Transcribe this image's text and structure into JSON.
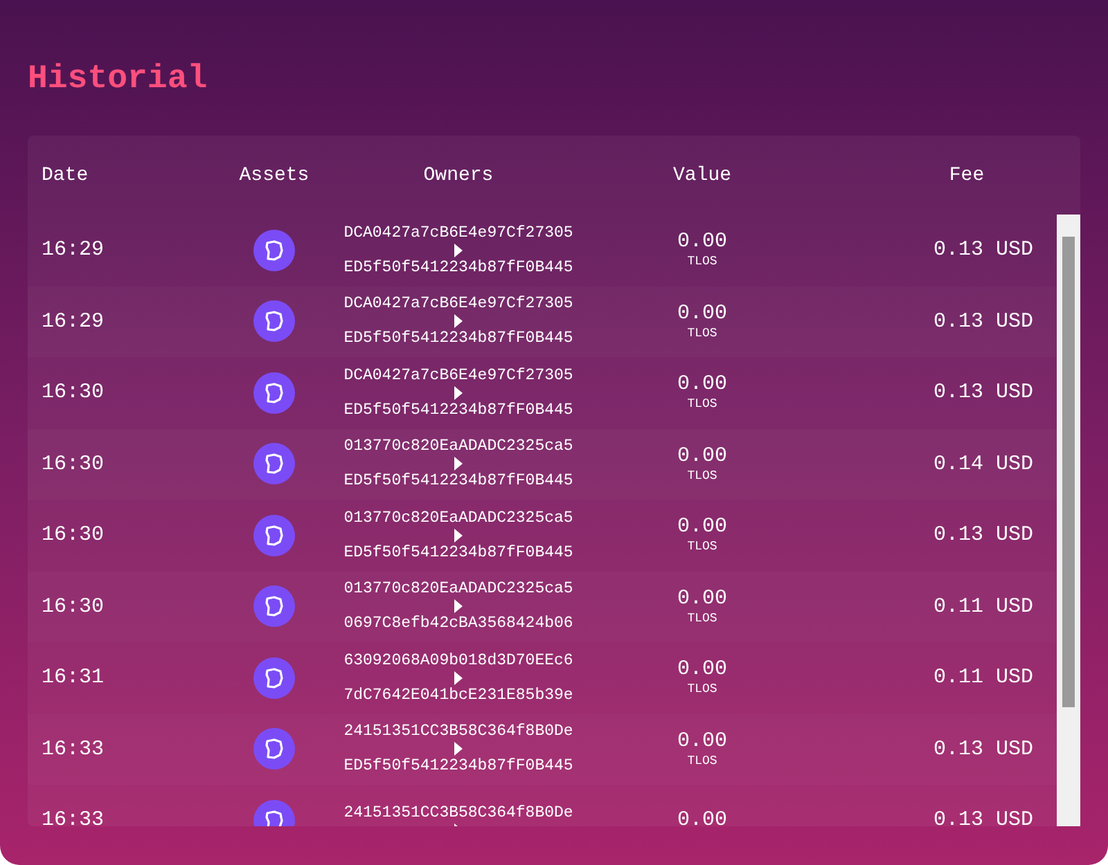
{
  "title": "Historial",
  "table": {
    "columns": [
      "Date",
      "Assets",
      "Owners",
      "Value",
      "Fee"
    ],
    "rows": [
      {
        "date": "16:29",
        "from": "DCA0427a7cB6E4e97Cf27305",
        "to": "ED5f50f5412234b87fF0B445",
        "value": "0.00",
        "unit": "TLOS",
        "fee": "0.13 USD"
      },
      {
        "date": "16:29",
        "from": "DCA0427a7cB6E4e97Cf27305",
        "to": "ED5f50f5412234b87fF0B445",
        "value": "0.00",
        "unit": "TLOS",
        "fee": "0.13 USD"
      },
      {
        "date": "16:30",
        "from": "DCA0427a7cB6E4e97Cf27305",
        "to": "ED5f50f5412234b87fF0B445",
        "value": "0.00",
        "unit": "TLOS",
        "fee": "0.13 USD"
      },
      {
        "date": "16:30",
        "from": "013770c820EaADADC2325ca5",
        "to": "ED5f50f5412234b87fF0B445",
        "value": "0.00",
        "unit": "TLOS",
        "fee": "0.14 USD"
      },
      {
        "date": "16:30",
        "from": "013770c820EaADADC2325ca5",
        "to": "ED5f50f5412234b87fF0B445",
        "value": "0.00",
        "unit": "TLOS",
        "fee": "0.13 USD"
      },
      {
        "date": "16:30",
        "from": "013770c820EaADADC2325ca5",
        "to": "0697C8efb42cBA3568424b06",
        "value": "0.00",
        "unit": "TLOS",
        "fee": "0.11 USD"
      },
      {
        "date": "16:31",
        "from": "63092068A09b018d3D70EEc6",
        "to": "7dC7642E041bcE231E85b39e",
        "value": "0.00",
        "unit": "TLOS",
        "fee": "0.11 USD"
      },
      {
        "date": "16:33",
        "from": "24151351CC3B58C364f8B0De",
        "to": "ED5f50f5412234b87fF0B445",
        "value": "0.00",
        "unit": "TLOS",
        "fee": "0.13 USD"
      },
      {
        "date": "16:33",
        "from": "24151351CC3B58C364f8B0De",
        "value": "0.00",
        "fee": "0.13 USD"
      }
    ]
  }
}
